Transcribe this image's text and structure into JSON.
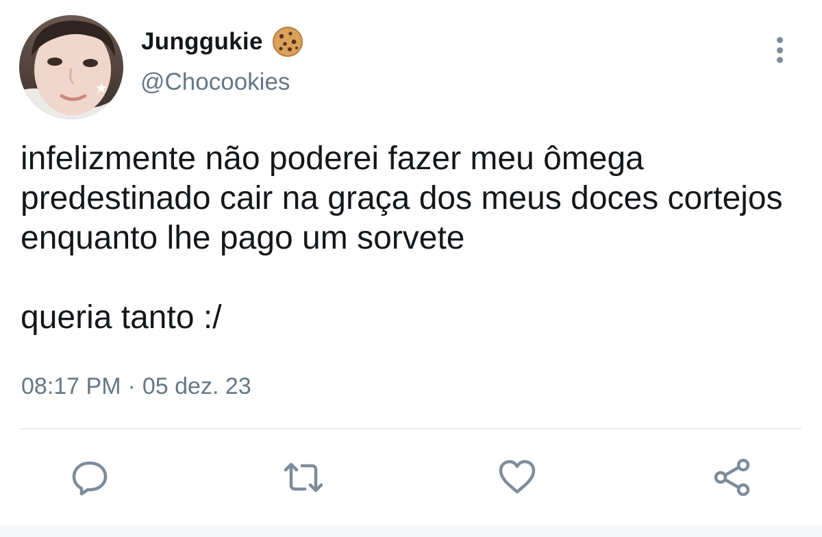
{
  "author": {
    "display_name": "Junggukie",
    "name_emoji_icon": "cookie-icon",
    "handle": "@Chocookies"
  },
  "tweet": {
    "paragraphs": [
      "infelizmente não poderei fazer meu ômega predestinado cair na graça dos meus doces cortejos enquanto lhe pago um sorvete",
      "queria tanto :/"
    ],
    "time": "08:17 PM",
    "separator": "·",
    "date": "05 dez. 23"
  },
  "actions": [
    {
      "name": "reply",
      "icon": "comment-icon"
    },
    {
      "name": "retweet",
      "icon": "retweet-icon"
    },
    {
      "name": "like",
      "icon": "heart-icon"
    },
    {
      "name": "share",
      "icon": "share-icon"
    }
  ],
  "more_menu_icon": "more-vertical-icon",
  "colors": {
    "text": "#14171a",
    "secondary": "#657786",
    "icon": "#7c8c9b",
    "divider": "#e6ecf0"
  }
}
